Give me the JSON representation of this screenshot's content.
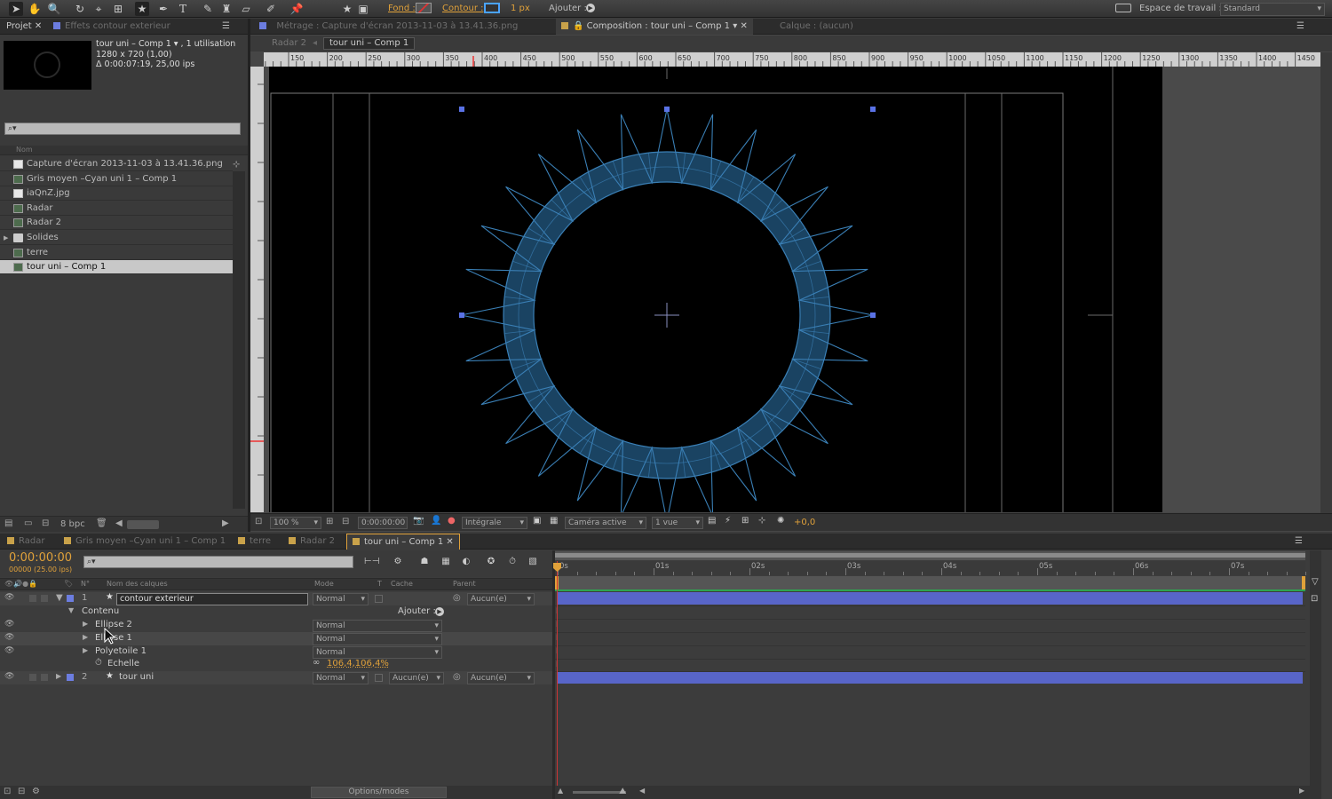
{
  "toolbar": {
    "fill_label": "Fond :",
    "stroke_label": "Contour :",
    "stroke_width": "1 px",
    "add_label": "Ajouter :",
    "workspace_label": "Espace de travail :",
    "workspace_value": "Standard"
  },
  "project": {
    "tab_project": "Projet",
    "tab_effects": "Effets contour exterieur",
    "preview_title": "tour uni – Comp 1 ▾ , 1 utilisation",
    "preview_size": "1280 x 720 (1,00)",
    "preview_duration": "Δ 0:00:07:19, 25,00 ips",
    "search_placeholder": "⌕▾",
    "col_name": "Nom",
    "bpc": "8 bpc",
    "items": [
      {
        "label": "Capture d'écran 2013-11-03 à 13.41.36.png",
        "kind": "file"
      },
      {
        "label": "Gris moyen –Cyan uni 1 – Comp 1",
        "kind": "comp"
      },
      {
        "label": "iaQnZ.jpg",
        "kind": "file"
      },
      {
        "label": "Radar",
        "kind": "comp"
      },
      {
        "label": "Radar 2",
        "kind": "comp"
      },
      {
        "label": "Solides",
        "kind": "folder"
      },
      {
        "label": "terre",
        "kind": "comp"
      },
      {
        "label": "tour uni – Comp 1",
        "kind": "comp"
      }
    ]
  },
  "viewer": {
    "tab_footage": "Métrage : Capture d'écran 2013-11-03 à 13.41.36.png",
    "tab_comp": "Composition : tour uni – Comp 1",
    "tab_layer": "Calque : (aucun)",
    "crumb1": "Radar 2",
    "crumb2": "tour uni – Comp 1",
    "ruler_labels": [
      "150",
      "200",
      "250",
      "300",
      "350",
      "400",
      "450",
      "500",
      "550",
      "600",
      "650",
      "700",
      "750",
      "800",
      "850",
      "900",
      "950",
      "1000",
      "1050",
      "1100",
      "1150",
      "1200",
      "1250",
      "1300",
      "1350",
      "1400",
      "1450"
    ],
    "zoom": "100 %",
    "timecode": "0:00:00:00",
    "resolution": "Intégrale",
    "camera": "Caméra active",
    "views": "1 vue",
    "exposure": "+0,0"
  },
  "timeline": {
    "tabs": [
      "Radar",
      "Gris moyen –Cyan uni 1 – Comp 1",
      "terre",
      "Radar 2",
      "tour uni – Comp 1"
    ],
    "timecode": "0:00:00:00",
    "frames": "00000 (25.00 ips)",
    "col_no": "N°",
    "col_name": "Nom des calques",
    "col_mode": "Mode",
    "col_t": "T",
    "col_matte": "Cache",
    "col_parent": "Parent",
    "time_labels": [
      "0s",
      "01s",
      "02s",
      "03s",
      "04s",
      "05s",
      "06s",
      "07s"
    ],
    "layer1": {
      "num": "1",
      "name": "contour exterieur",
      "mode": "Normal",
      "parent": "Aucun(e)"
    },
    "contents_label": "Contenu",
    "add_label": "Ajouter :",
    "sub": [
      {
        "name": "Ellipse 2",
        "mode": "Normal"
      },
      {
        "name": "Ellipse 1",
        "mode": "Normal"
      },
      {
        "name": "Polyetoile 1",
        "mode": "Normal"
      }
    ],
    "scale_label": "Echelle",
    "scale_value": "106,4,106,4%",
    "layer2": {
      "num": "2",
      "name": "tour uni",
      "mode": "Normal",
      "matte": "Aucun(e)",
      "parent": "Aucun(e)"
    },
    "switches_label": "Options/modes"
  }
}
